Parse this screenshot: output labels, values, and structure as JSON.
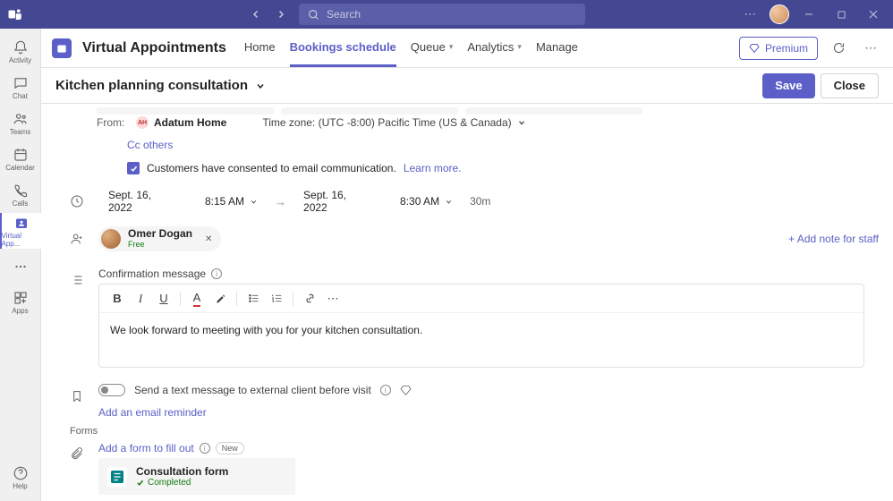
{
  "titlebar": {
    "search_placeholder": "Search"
  },
  "rail": {
    "activity": "Activity",
    "chat": "Chat",
    "teams": "Teams",
    "calendar": "Calendar",
    "calls": "Calls",
    "virtual": "Virtual App...",
    "apps": "Apps",
    "help": "Help"
  },
  "app": {
    "title": "Virtual Appointments",
    "tabs": {
      "home": "Home",
      "bookings": "Bookings schedule",
      "queue": "Queue",
      "analytics": "Analytics",
      "manage": "Manage"
    },
    "premium": "Premium"
  },
  "page": {
    "title": "Kitchen planning consultation",
    "save": "Save",
    "close": "Close"
  },
  "form": {
    "from_label": "From:",
    "org_name": "Adatum Home",
    "timezone": "Time zone: (UTC -8:00) Pacific Time (US & Canada)",
    "cc_others": "Cc others",
    "consent_text": "Customers have consented to email communication.",
    "learn_more": "Learn more.",
    "start_date": "Sept. 16, 2022",
    "start_time": "8:15 AM",
    "end_date": "Sept. 16, 2022",
    "end_time": "8:30 AM",
    "duration": "30m",
    "staff": {
      "name": "Omer Dogan",
      "status": "Free"
    },
    "add_note": "+ Add note for staff",
    "confirmation_label": "Confirmation message",
    "message_body": "We look forward to meeting with you for your kitchen consultation.",
    "sms_label": "Send a text message to external client before visit",
    "add_email_reminder": "Add an email reminder",
    "forms_section": "Forms",
    "add_form": "Add a form to fill out",
    "new_pill": "New",
    "form_card": {
      "name": "Consultation form",
      "status": "Completed"
    }
  }
}
